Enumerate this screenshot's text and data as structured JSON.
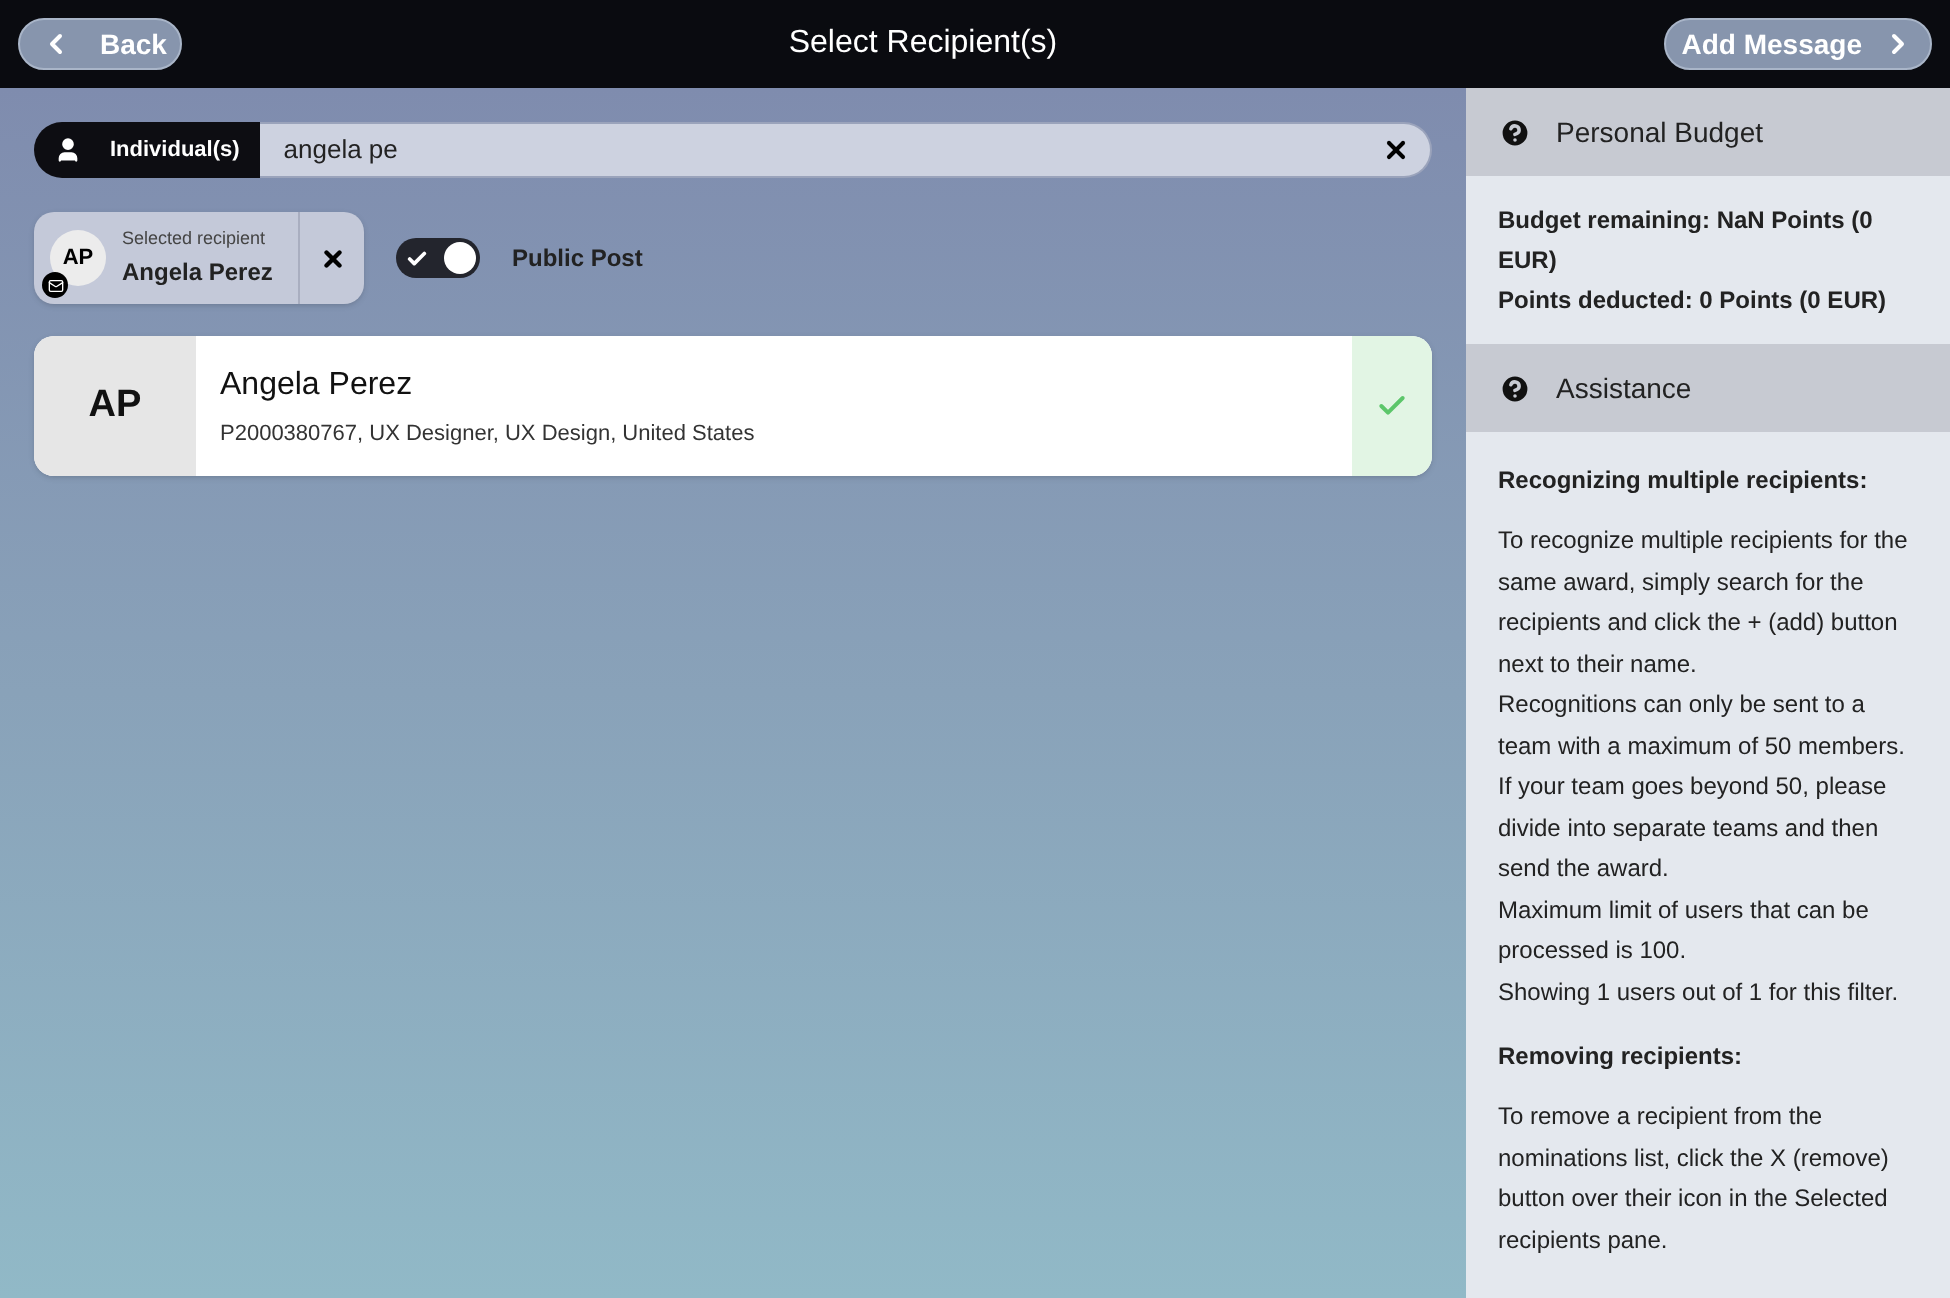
{
  "header": {
    "back": "Back",
    "title": "Select Recipient(s)",
    "next": "Add Message"
  },
  "search": {
    "mode": "Individual(s)",
    "value": "angela pe"
  },
  "selected_recipient": {
    "initials": "AP",
    "caption": "Selected recipient",
    "name": "Angela Perez"
  },
  "public_post": {
    "label": "Public Post",
    "on": true
  },
  "results": [
    {
      "initials": "AP",
      "name": "Angela Perez",
      "details": "P2000380767, UX Designer, UX Design, United States",
      "selected": true
    }
  ],
  "sidebar": {
    "sections": [
      {
        "title": "Personal Budget",
        "blocks": [
          {
            "kind": "lines",
            "lines": [
              "Budget remaining: NaN Points (0 EUR)",
              "Points deducted: 0 Points (0 EUR)"
            ]
          }
        ]
      },
      {
        "title": "Assistance",
        "blocks": [
          {
            "kind": "heading",
            "text": "Recognizing multiple recipients:"
          },
          {
            "kind": "paragraphs",
            "lines": [
              "To recognize multiple recipients for the same award, simply search for the recipients and click the + (add) button next to their name.",
              "Recognitions can only be sent to a team with a maximum of 50 members.",
              "If your team goes beyond 50, please divide into separate teams and then send the award.",
              "Maximum limit of users that can be processed is 100.",
              "Showing 1 users out of 1 for this filter."
            ]
          },
          {
            "kind": "heading",
            "text": "Removing recipients:"
          },
          {
            "kind": "paragraphs",
            "lines": [
              "To remove a recipient from the nominations list, click the X (remove) button over their icon in the Selected recipients pane."
            ]
          }
        ]
      }
    ]
  }
}
